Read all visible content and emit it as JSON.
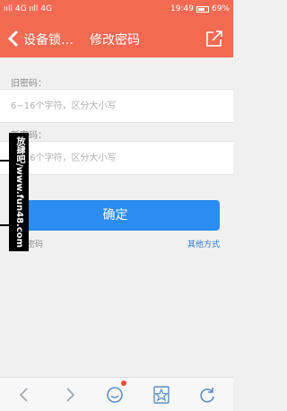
{
  "status_bar": {
    "left_text": "ııll 4G ııll 4G",
    "time": "19:49",
    "battery": "69%"
  },
  "nav": {
    "back_label": "设备锁…",
    "title": "修改密码"
  },
  "form": {
    "old_password_label": "旧密码：",
    "old_password_placeholder": "6~16个字符，区分大小写",
    "new_password_label": "新密码：",
    "new_password_placeholder": "6~16个字符，区分大小写",
    "confirm_label": "确定",
    "show_password_label": "显示密码",
    "other_methods_label": "其他方式"
  },
  "watermark": {
    "text": "放肆吧/www.fun48.com"
  },
  "colors": {
    "accent": "#f26a52",
    "button": "#2b8cf2",
    "link": "#2b78d8"
  },
  "bottom_bar": {
    "icons": [
      "back-arrow-icon",
      "forward-arrow-icon",
      "chat-icon",
      "bookmark-star-icon",
      "refresh-icon"
    ]
  }
}
